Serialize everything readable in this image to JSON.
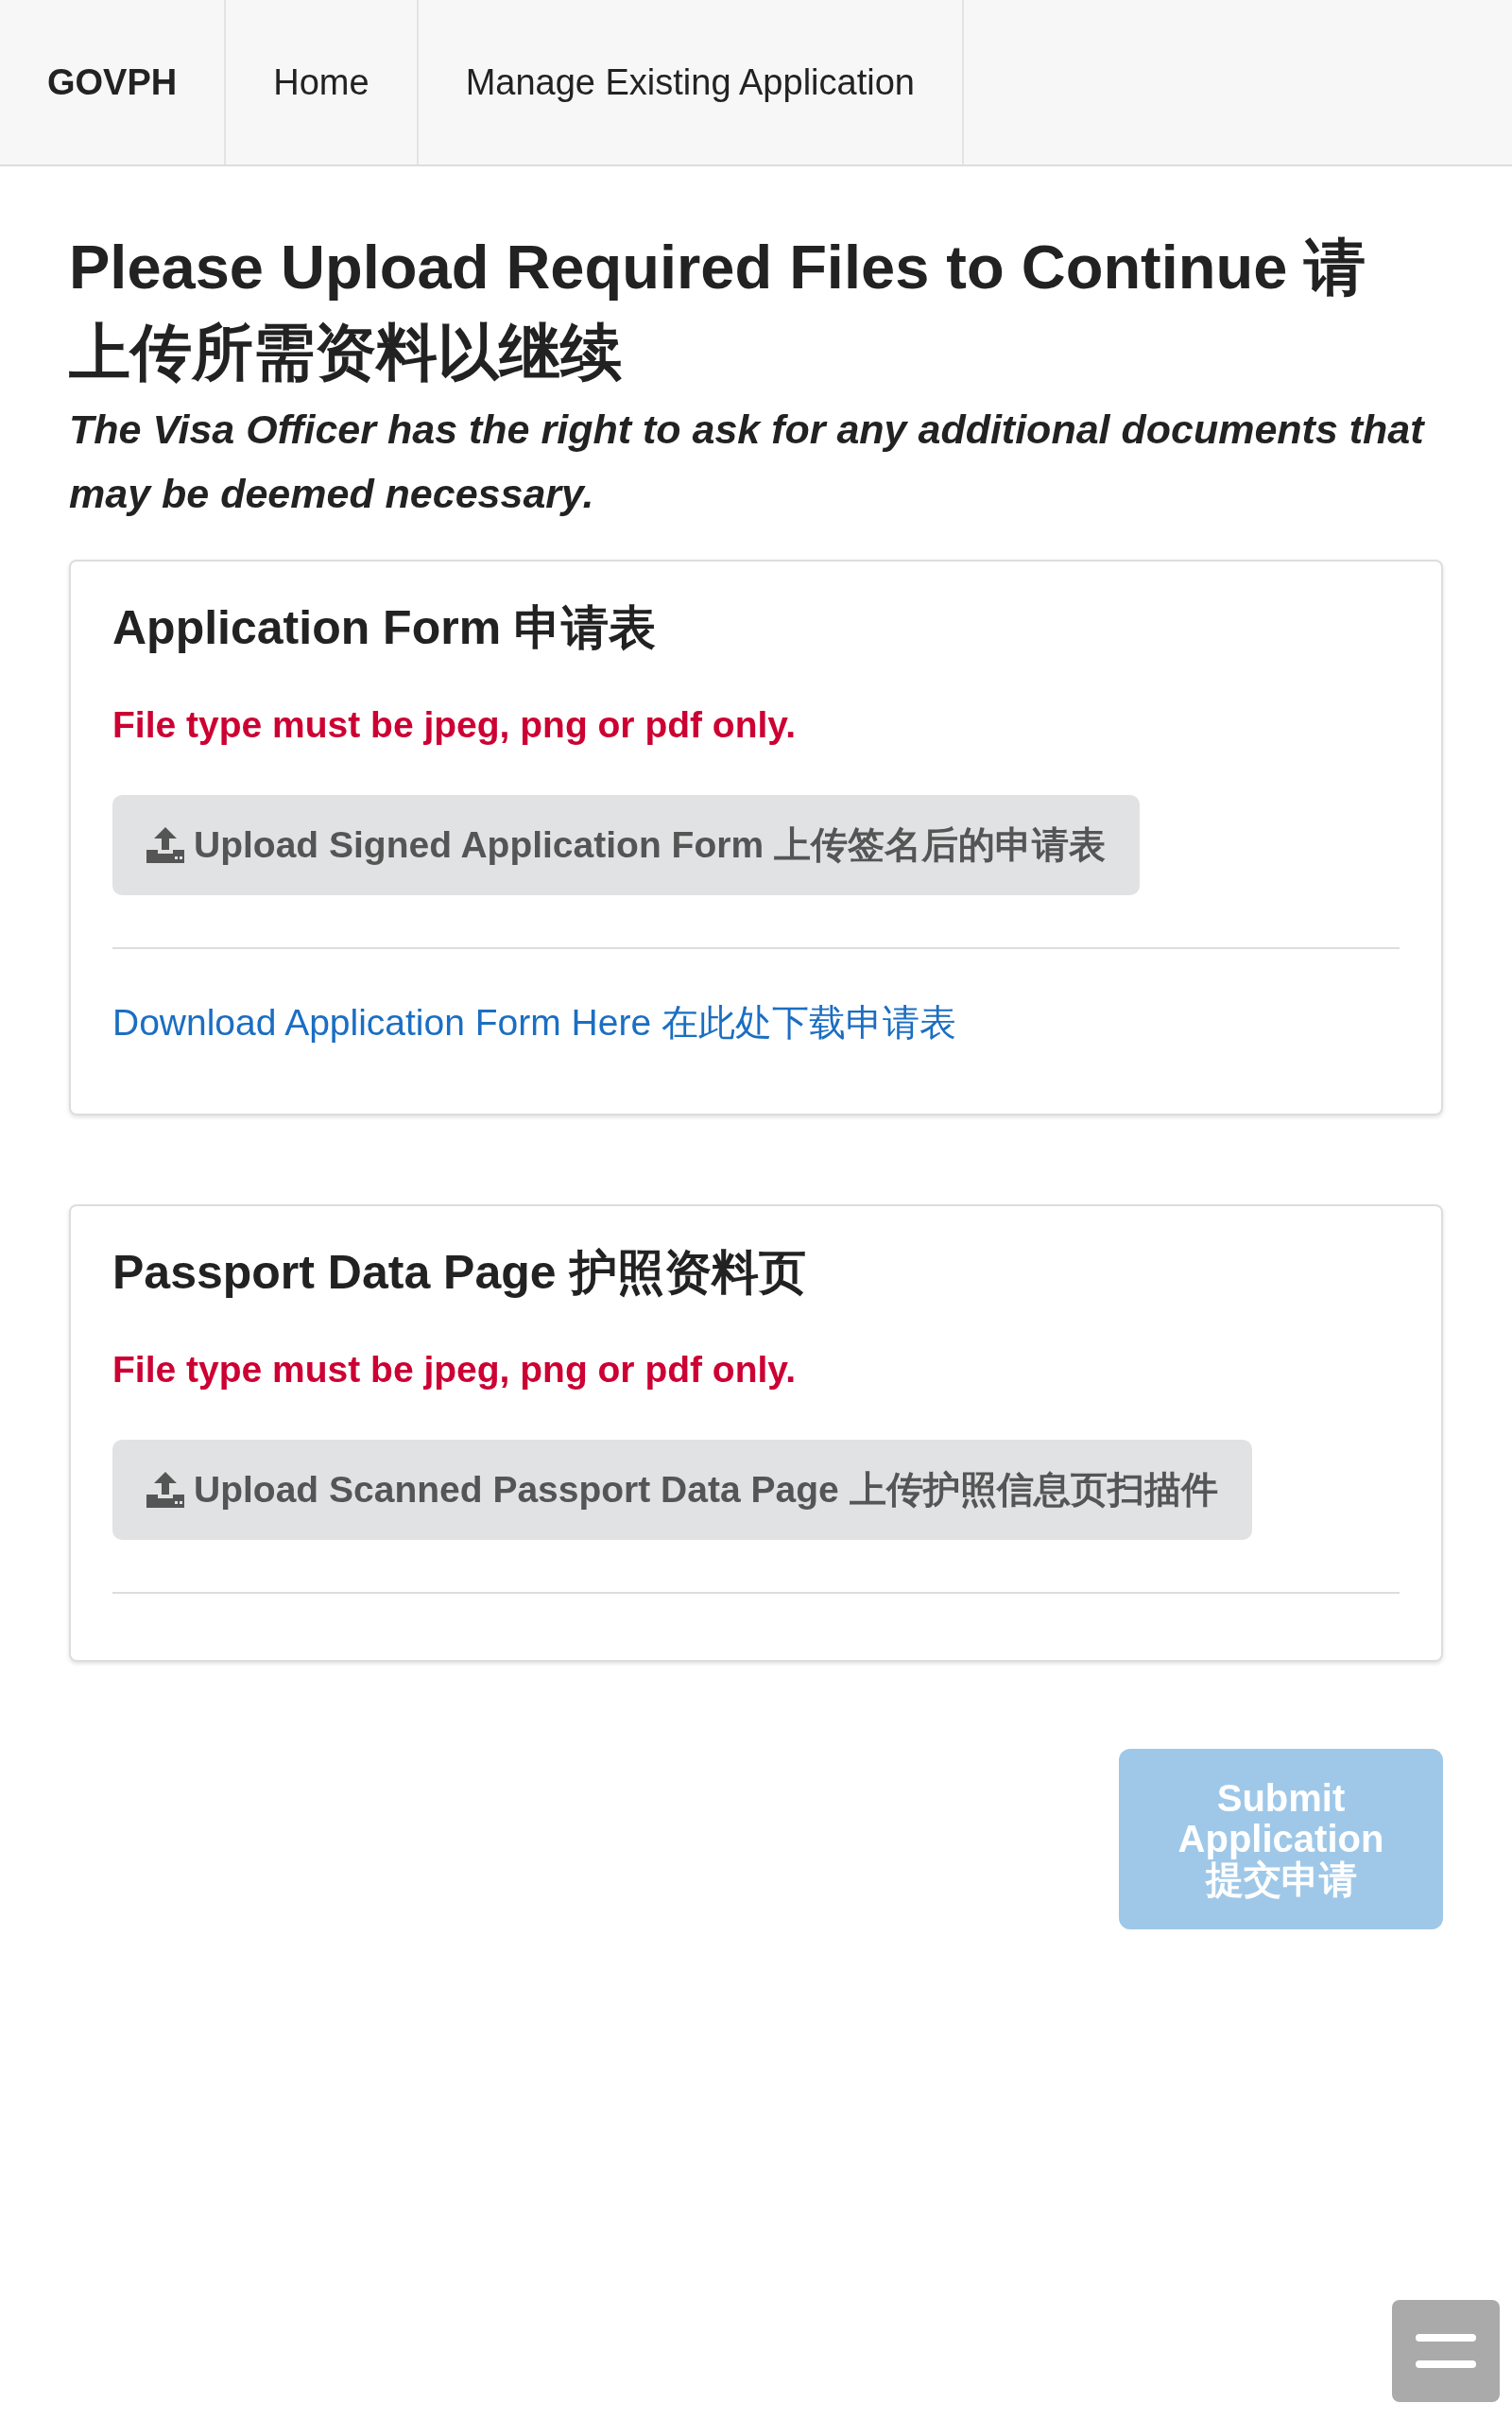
{
  "nav": {
    "brand": "GOVPH",
    "items": [
      {
        "label": "Home"
      },
      {
        "label": "Manage Existing Application"
      }
    ]
  },
  "page": {
    "title": "Please Upload Required Files to Continue 请上传所需资料以继续",
    "notice": "The Visa Officer has the right to ask for any additional documents that may be deemed necessary."
  },
  "sections": [
    {
      "title": "Application Form 申请表",
      "file_type_note": "File type must be jpeg, png or pdf only.",
      "upload_button": "Upload Signed Application Form 上传签名后的申请表",
      "download_link": "Download Application Form Here 在此处下载申请表"
    },
    {
      "title": "Passport Data Page 护照资料页",
      "file_type_note": "File type must be jpeg, png or pdf only.",
      "upload_button": "Upload Scanned Passport Data Page 上传护照信息页扫描件"
    }
  ],
  "submit_button": {
    "label": "Submit Application 提交申请",
    "disabled": true
  }
}
